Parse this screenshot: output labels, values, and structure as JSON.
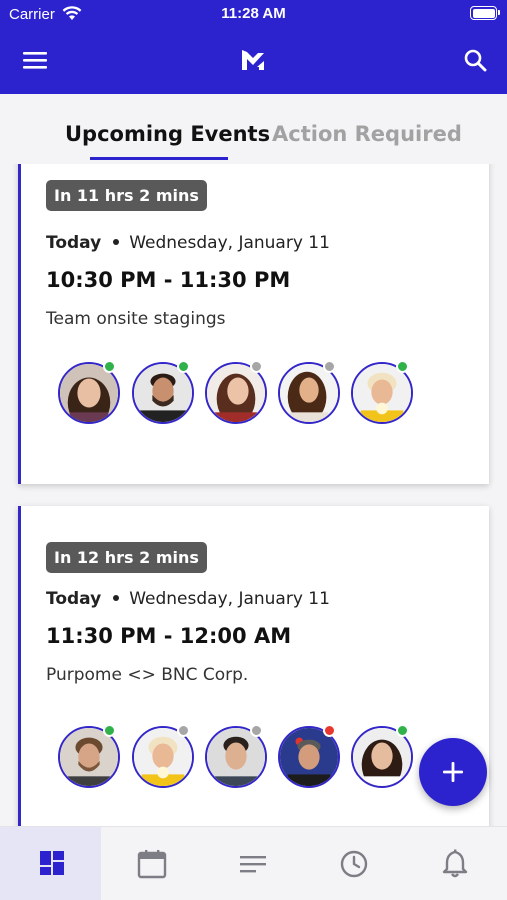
{
  "status_bar": {
    "carrier": "Carrier",
    "time": "11:28 AM"
  },
  "header": {
    "menu_icon": "hamburger-menu-icon",
    "logo_icon": "app-logo-icon",
    "search_icon": "search-icon"
  },
  "tabs": [
    {
      "label": "Upcoming Events",
      "active": true
    },
    {
      "label": "Action Required",
      "active": false
    }
  ],
  "events": [
    {
      "badge": "In 11 hrs 2 mins",
      "day": "Today",
      "date": "Wednesday, January 11",
      "time": "10:30 PM - 11:30 PM",
      "title": "Team onsite stagings",
      "attendees": [
        {
          "status": "online",
          "status_color": "#2fb24a"
        },
        {
          "status": "online",
          "status_color": "#2fb24a"
        },
        {
          "status": "away",
          "status_color": "#a6a6a6"
        },
        {
          "status": "away",
          "status_color": "#a6a6a6"
        },
        {
          "status": "online",
          "status_color": "#2fb24a"
        }
      ]
    },
    {
      "badge": "In 12 hrs 2 mins",
      "day": "Today",
      "date": "Wednesday, January 11",
      "time": "11:30 PM - 12:00 AM",
      "title": "Purpome <> BNC Corp.",
      "attendees": [
        {
          "status": "online",
          "status_color": "#2fb24a"
        },
        {
          "status": "away",
          "status_color": "#a6a6a6"
        },
        {
          "status": "away",
          "status_color": "#a6a6a6"
        },
        {
          "status": "busy",
          "status_color": "#e8372c"
        },
        {
          "status": "online",
          "status_color": "#2fb24a"
        }
      ]
    }
  ],
  "fab": {
    "icon": "plus-icon"
  },
  "bottom_nav": [
    {
      "icon": "dashboard-icon",
      "active": true
    },
    {
      "icon": "calendar-icon",
      "active": false
    },
    {
      "icon": "list-icon",
      "active": false
    },
    {
      "icon": "clock-icon",
      "active": false
    },
    {
      "icon": "bell-icon",
      "active": false
    }
  ],
  "colors": {
    "brand": "#2c23cf",
    "badge": "#595959",
    "online": "#2fb24a",
    "away": "#a6a6a6",
    "busy": "#e8372c"
  }
}
